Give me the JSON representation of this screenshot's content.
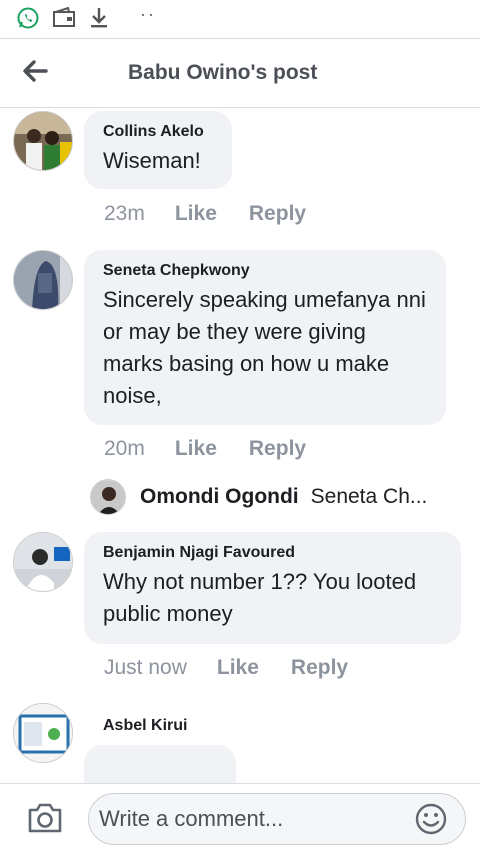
{
  "status_bar": {
    "icons": [
      "whatsapp-icon",
      "wallet-icon",
      "download-icon"
    ],
    "dots": "··"
  },
  "header": {
    "back_icon": "arrow-left-icon",
    "title": "Babu Owino's post"
  },
  "comments": [
    {
      "author": "Collins Akelo",
      "text": "Wiseman!",
      "time": "23m",
      "like": "Like",
      "reply": "Reply"
    },
    {
      "author": "Seneta Chepkwony",
      "text": "Sincerely speaking umefanya nni or may be they were giving marks basing on  how u make noise,",
      "time": "20m",
      "like": "Like",
      "reply": "Reply",
      "reply_preview": {
        "author": "Omondi Ogondi",
        "text": "Seneta Ch..."
      }
    },
    {
      "author": "Benjamin Njagi Favoured",
      "text": "Why not number 1?? You looted public money",
      "time": "Just now",
      "like": "Like",
      "reply": "Reply"
    },
    {
      "author": "Asbel Kirui",
      "text": ""
    }
  ],
  "composer": {
    "camera_icon": "camera-icon",
    "placeholder": "Write a comment...",
    "emoji_icon": "smiley-icon"
  }
}
